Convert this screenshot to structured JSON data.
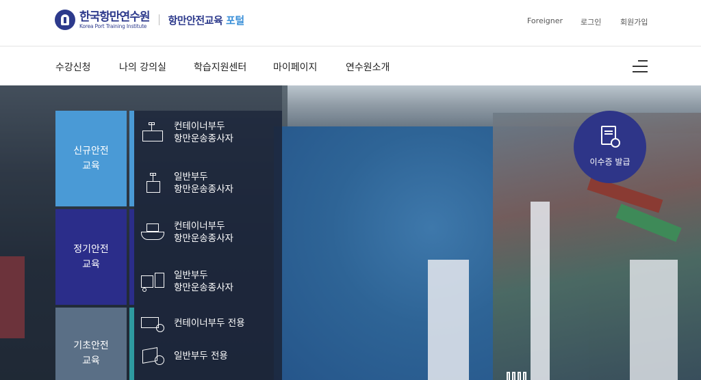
{
  "header": {
    "logo_ko": "한국항만연수원",
    "logo_en": "Korea Port Training Institute",
    "portal_main": "항만안전교육",
    "portal_accent": "포털",
    "links": [
      "Foreigner",
      "로그인",
      "회원가입"
    ]
  },
  "nav": {
    "items": [
      "수강신청",
      "나의 강의실",
      "학습지원센터",
      "마이페이지",
      "연수원소개"
    ],
    "menu_icon": "hamburger-icon"
  },
  "categories": [
    {
      "label": "신규안전\n교육",
      "color": "#4a9ad6",
      "bar_color": "#4a9ad6",
      "items": [
        {
          "icon": "container-crane-icon",
          "line1": "컨테이너부두",
          "line2": "항만운송종사자"
        },
        {
          "icon": "box-crane-icon",
          "line1": "일반부두",
          "line2": "항만운송종사자"
        }
      ]
    },
    {
      "label": "정기안전\n교육",
      "color": "#2b2d8a",
      "bar_color": "#2b2d8a",
      "items": [
        {
          "icon": "container-ship-icon",
          "line1": "컨테이너부두",
          "line2": "항만운송종사자"
        },
        {
          "icon": "forklift-icon",
          "line1": "일반부두",
          "line2": "항만운송종사자"
        }
      ]
    },
    {
      "label": "기초안전\n교육",
      "color": "#5a6f86",
      "bar_color": "#2e9aa0",
      "items": [
        {
          "icon": "container-clock-icon",
          "line1": "컨테이너부두 전용",
          "line2": ""
        },
        {
          "icon": "box-clock-icon",
          "line1": "일반부두 전용",
          "line2": ""
        }
      ]
    }
  ],
  "badge": {
    "label": "이수증 발급",
    "icon": "certificate-icon",
    "color": "#2e3588"
  }
}
